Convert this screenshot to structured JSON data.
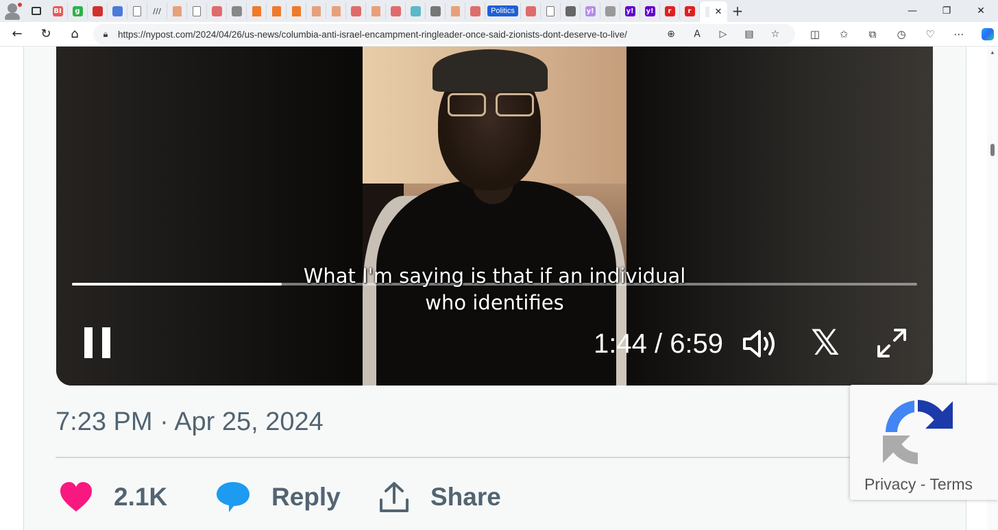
{
  "browser": {
    "tabs": [
      {
        "icon": "bi-favicon",
        "text": "BI",
        "color": "#e35b5b"
      },
      {
        "icon": "g-favicon",
        "text": "g",
        "color": "#2bb24c"
      },
      {
        "icon": "download-favicon",
        "text": "",
        "color": "#d32f2f"
      },
      {
        "icon": "search-favicon",
        "text": "",
        "color": "#4a7bd8"
      },
      {
        "icon": "doc-favicon",
        "text": "",
        "color": "#ffffff"
      },
      {
        "icon": "lines-favicon",
        "text": "",
        "color": "#555555"
      },
      {
        "icon": "bookmark-favicon",
        "text": "",
        "color": "#e8a07a"
      },
      {
        "icon": "doc-favicon",
        "text": "",
        "color": "#ffffff"
      },
      {
        "icon": "youtube-favicon",
        "text": "",
        "color": "#e06b6b"
      },
      {
        "icon": "image-favicon",
        "text": "",
        "color": "#888888"
      },
      {
        "icon": "bookmark-favicon",
        "text": "",
        "color": "#f07a2a"
      },
      {
        "icon": "bookmark-favicon",
        "text": "",
        "color": "#f07a2a"
      },
      {
        "icon": "bookmark-favicon",
        "text": "",
        "color": "#f07a2a"
      },
      {
        "icon": "bookmark-favicon",
        "text": "",
        "color": "#e8a07a"
      },
      {
        "icon": "bookmark-favicon",
        "text": "",
        "color": "#e8a07a"
      },
      {
        "icon": "youtube-favicon",
        "text": "",
        "color": "#e06b6b"
      },
      {
        "icon": "bookmark-favicon",
        "text": "",
        "color": "#e8a07a"
      },
      {
        "icon": "youtube-favicon",
        "text": "",
        "color": "#e06b6b"
      },
      {
        "icon": "p-favicon",
        "text": "",
        "color": "#5bb8c9"
      },
      {
        "icon": "image-favicon",
        "text": "",
        "color": "#777777"
      },
      {
        "icon": "bookmark-favicon",
        "text": "",
        "color": "#e8a07a"
      },
      {
        "icon": "youtube-favicon",
        "text": "",
        "color": "#e06b6b"
      }
    ],
    "politics_tab": "Politics",
    "tabs_after": [
      {
        "icon": "youtube-favicon",
        "text": "",
        "color": "#e06b6b"
      },
      {
        "icon": "doc-favicon",
        "text": "",
        "color": "#ffffff"
      },
      {
        "icon": "image-favicon",
        "text": "",
        "color": "#666666"
      },
      {
        "icon": "yahoo-favicon",
        "text": "y!",
        "color": "#b78be8"
      },
      {
        "icon": "w-favicon",
        "text": "",
        "color": "#999999"
      },
      {
        "icon": "yahoo-favicon",
        "text": "y!",
        "color": "#6001d2"
      },
      {
        "icon": "yahoo-favicon",
        "text": "y!",
        "color": "#6001d2"
      },
      {
        "icon": "r-favicon",
        "text": "r",
        "color": "#e02020"
      },
      {
        "icon": "r-favicon",
        "text": "r",
        "color": "#e02020"
      }
    ],
    "active_tab_close": "✕",
    "new_tab": "+",
    "window_controls": {
      "minimize": "—",
      "maximize": "❐",
      "close": "✕"
    },
    "url": "https://nypost.com/2024/04/26/us-news/columbia-anti-israel-encampment-ringleader-once-said-zionists-dont-deserve-to-live/"
  },
  "video": {
    "caption_line1": "What I'm saying is that if an individual",
    "caption_line2": "who identifies",
    "time": "1:44 / 6:59",
    "progress": 0.248
  },
  "tweet": {
    "timestamp": "7:23 PM · Apr 25, 2024",
    "like_count": "2.1K",
    "reply_label": "Reply",
    "share_label": "Share",
    "like_color": "#f91880",
    "reply_color": "#1d9bf0"
  },
  "recaptcha": {
    "privacy": "Privacy",
    "separator": " - ",
    "terms": "Terms"
  }
}
